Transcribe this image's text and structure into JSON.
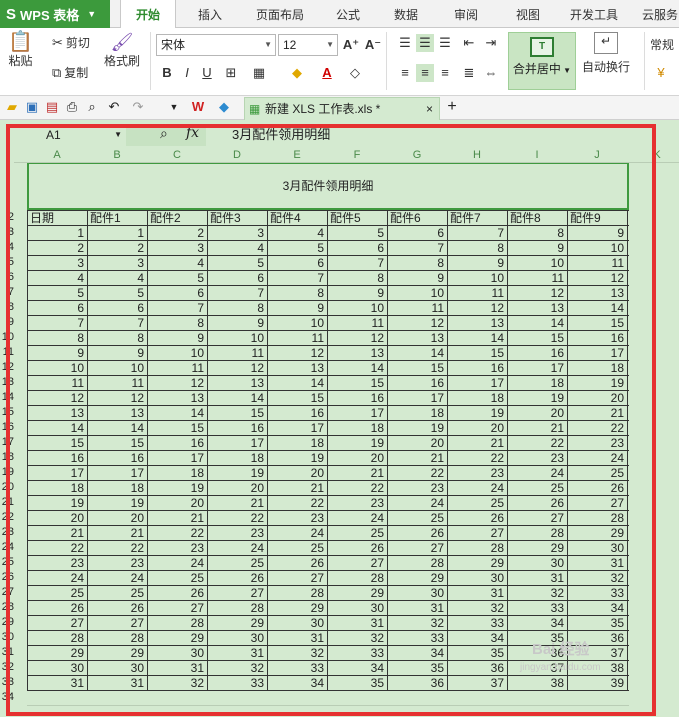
{
  "app": {
    "name": "WPS 表格"
  },
  "tabs": [
    "开始",
    "插入",
    "页面布局",
    "公式",
    "数据",
    "审阅",
    "视图",
    "开发工具",
    "云服务"
  ],
  "active_tab": 0,
  "ribbon": {
    "paste_label": "粘贴",
    "cut_label": "剪切",
    "copy_label": "复制",
    "format_painter_label": "格式刷",
    "font_name": "宋体",
    "font_size": "12",
    "merge_label": "合并居中",
    "wrap_label": "自动换行",
    "number_format": "常规"
  },
  "document": {
    "tab_name": "新建 XLS 工作表.xls *"
  },
  "formula_bar": {
    "cell_ref": "A1",
    "fx_label": "fx",
    "content": "3月配件领用明细"
  },
  "sheet": {
    "columns": [
      "A",
      "B",
      "C",
      "D",
      "E",
      "F",
      "G",
      "H",
      "I",
      "J",
      "K"
    ],
    "title": "3月配件领用明细",
    "headers": [
      "日期",
      "配件1",
      "配件2",
      "配件3",
      "配件4",
      "配件5",
      "配件6",
      "配件7",
      "配件8",
      "配件9"
    ],
    "row_numbers": [
      "2",
      "3",
      "4",
      "5",
      "6",
      "7",
      "8",
      "9",
      "10",
      "11",
      "12",
      "13",
      "14",
      "15",
      "16",
      "17",
      "18",
      "19",
      "20",
      "21",
      "22",
      "23",
      "24",
      "25",
      "26",
      "27",
      "28",
      "29",
      "30",
      "31",
      "32",
      "33",
      "34"
    ],
    "rows": [
      [
        1,
        1,
        2,
        3,
        4,
        5,
        6,
        7,
        8,
        9
      ],
      [
        2,
        2,
        3,
        4,
        5,
        6,
        7,
        8,
        9,
        10
      ],
      [
        3,
        3,
        4,
        5,
        6,
        7,
        8,
        9,
        10,
        11
      ],
      [
        4,
        4,
        5,
        6,
        7,
        8,
        9,
        10,
        11,
        12
      ],
      [
        5,
        5,
        6,
        7,
        8,
        9,
        10,
        11,
        12,
        13
      ],
      [
        6,
        6,
        7,
        8,
        9,
        10,
        11,
        12,
        13,
        14
      ],
      [
        7,
        7,
        8,
        9,
        10,
        11,
        12,
        13,
        14,
        15
      ],
      [
        8,
        8,
        9,
        10,
        11,
        12,
        13,
        14,
        15,
        16
      ],
      [
        9,
        9,
        10,
        11,
        12,
        13,
        14,
        15,
        16,
        17
      ],
      [
        10,
        10,
        11,
        12,
        13,
        14,
        15,
        16,
        17,
        18
      ],
      [
        11,
        11,
        12,
        13,
        14,
        15,
        16,
        17,
        18,
        19
      ],
      [
        12,
        12,
        13,
        14,
        15,
        16,
        17,
        18,
        19,
        20
      ],
      [
        13,
        13,
        14,
        15,
        16,
        17,
        18,
        19,
        20,
        21
      ],
      [
        14,
        14,
        15,
        16,
        17,
        18,
        19,
        20,
        21,
        22
      ],
      [
        15,
        15,
        16,
        17,
        18,
        19,
        20,
        21,
        22,
        23
      ],
      [
        16,
        16,
        17,
        18,
        19,
        20,
        21,
        22,
        23,
        24
      ],
      [
        17,
        17,
        18,
        19,
        20,
        21,
        22,
        23,
        24,
        25
      ],
      [
        18,
        18,
        19,
        20,
        21,
        22,
        23,
        24,
        25,
        26
      ],
      [
        19,
        19,
        20,
        21,
        22,
        23,
        24,
        25,
        26,
        27
      ],
      [
        20,
        20,
        21,
        22,
        23,
        24,
        25,
        26,
        27,
        28
      ],
      [
        21,
        21,
        22,
        23,
        24,
        25,
        26,
        27,
        28,
        29
      ],
      [
        22,
        22,
        23,
        24,
        25,
        26,
        27,
        28,
        29,
        30
      ],
      [
        23,
        23,
        24,
        25,
        26,
        27,
        28,
        29,
        30,
        31
      ],
      [
        24,
        24,
        25,
        26,
        27,
        28,
        29,
        30,
        31,
        32
      ],
      [
        25,
        25,
        26,
        27,
        28,
        29,
        30,
        31,
        32,
        33
      ],
      [
        26,
        26,
        27,
        28,
        29,
        30,
        31,
        32,
        33,
        34
      ],
      [
        27,
        27,
        28,
        29,
        30,
        31,
        32,
        33,
        34,
        35
      ],
      [
        28,
        28,
        29,
        30,
        31,
        32,
        33,
        34,
        35,
        36
      ],
      [
        29,
        29,
        30,
        31,
        32,
        33,
        34,
        35,
        36,
        37
      ],
      [
        30,
        30,
        31,
        32,
        33,
        34,
        35,
        36,
        37,
        38
      ],
      [
        31,
        31,
        32,
        33,
        34,
        35,
        36,
        37,
        38,
        39
      ]
    ]
  },
  "colors": {
    "app_green": "#3c9a3c",
    "sheet_bg": "#d4ead0",
    "highlight_frame": "#e63030"
  },
  "watermark": {
    "text": "Bai 经验",
    "url": "jingyan.baidu.com"
  }
}
